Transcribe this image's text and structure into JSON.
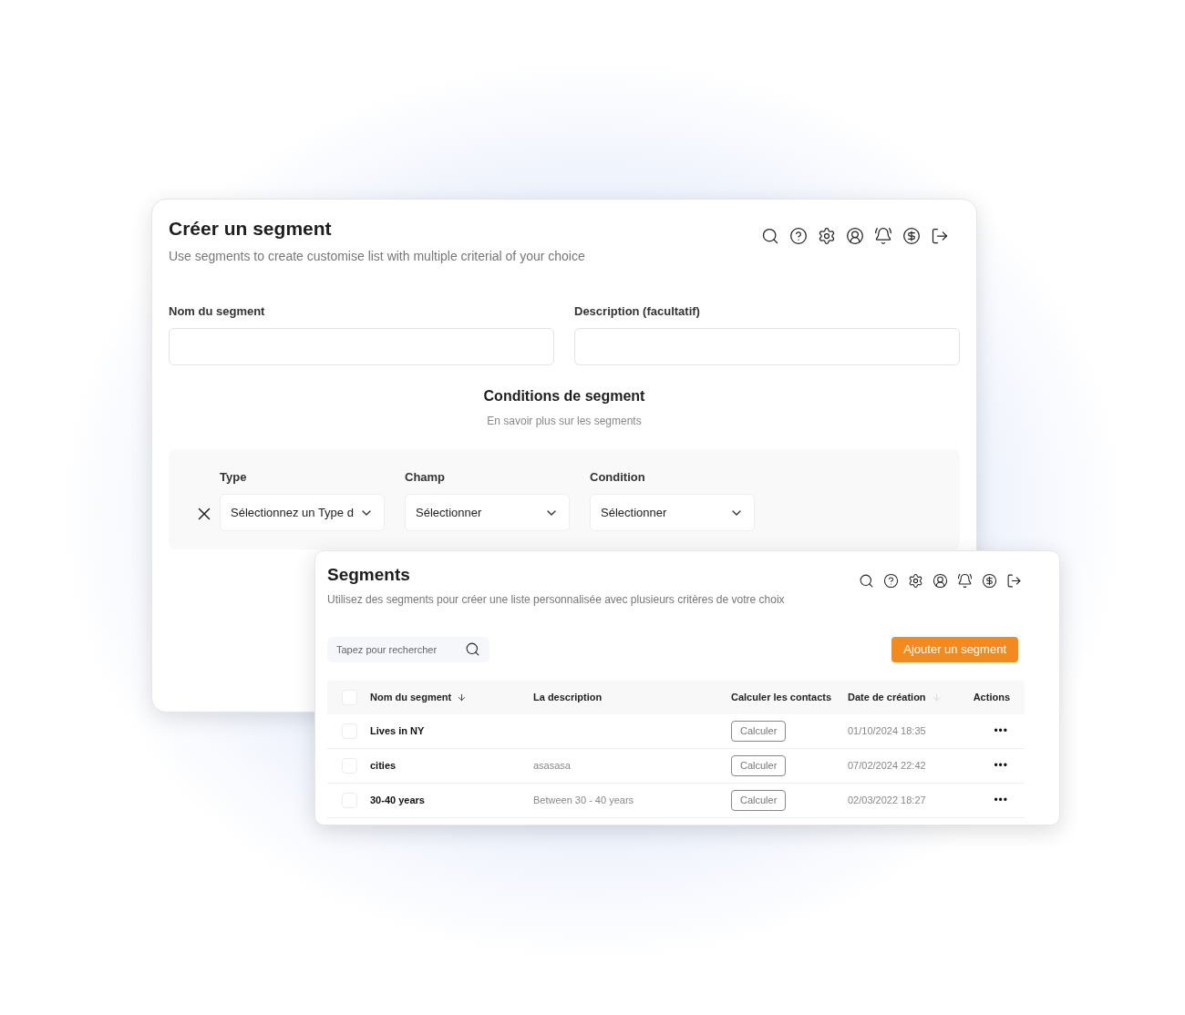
{
  "create_window": {
    "title": "Créer un segment",
    "subtitle": "Use segments to create customise list with multiple criterial of your choice",
    "fields": [
      {
        "label": "Nom du segment"
      },
      {
        "label": "Description (facultatif)"
      }
    ],
    "conditions": {
      "title": "Conditions de segment",
      "link": "En savoir plus sur les segments",
      "selects": [
        {
          "label": "Type",
          "value": "Sélectionnez un Type d"
        },
        {
          "label": "Champ",
          "value": "Sélectionner"
        },
        {
          "label": "Condition",
          "value": "Sélectionner"
        }
      ]
    }
  },
  "list_window": {
    "title": "Segments",
    "subtitle": "Utilisez des segments pour créer une liste personnalisée avec plusieurs critères de votre choix",
    "search": {
      "placeholder": "Tapez pour rechercher"
    },
    "add_button": "Ajouter un segment",
    "table": {
      "all_checked": false,
      "columns": [
        {
          "label": "Nom du segment",
          "sorted": true
        },
        {
          "label": "La description"
        },
        {
          "label": "Calculer les contacts"
        },
        {
          "label": "Date de création",
          "sorted": false
        },
        {
          "label": "Actions"
        }
      ],
      "rows": [
        {
          "checked": false,
          "name": "Lives in NY",
          "action": "Calculer",
          "date": "01/10/2024 18:35",
          "menu": "•••"
        },
        {
          "checked": false,
          "name": "cities",
          "description": "asasasa",
          "action": "Calculer",
          "date": "07/02/2024 22:42",
          "menu": "•••"
        },
        {
          "checked": false,
          "name": "30-40 years",
          "description": "Between 30 - 40 years",
          "action": "Calculer",
          "date": "02/03/2022 18:27",
          "menu": "•••"
        }
      ]
    }
  }
}
